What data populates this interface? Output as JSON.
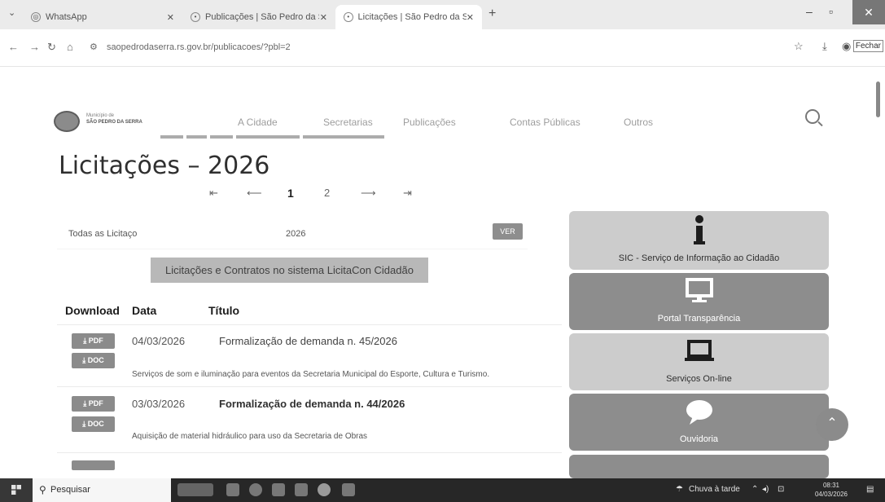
{
  "browser": {
    "tabs": [
      {
        "label": "WhatsApp"
      },
      {
        "label": "Publicações | São Pedro da Ser"
      },
      {
        "label": "Licitações | São Pedro da Serra"
      }
    ],
    "url": "saopedrodaserra.rs.gov.br/publicacoes/?pbl=2",
    "fechar_label": "Fechar"
  },
  "site": {
    "logo_small": "Município de",
    "logo_name": "SÃO PEDRO DA SERRA",
    "menu": [
      "A Cidade",
      "Secretarias",
      "Publicações",
      "Contas Públicas",
      "Outros"
    ]
  },
  "page": {
    "title": "Licitações – 2026",
    "pagination": {
      "first": "⇤",
      "prev": "⟵",
      "pages": [
        "1",
        "2"
      ],
      "next": "⟶",
      "last": "⇥"
    },
    "filter": {
      "category": "Todas as Licitaço",
      "year": "2026",
      "button": "VER"
    },
    "licitacon_button": "Licitações e Contratos no sistema LicitaCon Cidadão",
    "table": {
      "headers": [
        "Download",
        "Data",
        "Título"
      ],
      "pdf_label": "PDF",
      "doc_label": "DOC",
      "rows": [
        {
          "date": "04/03/2026",
          "title": "Formalização de demanda n. 45/2026",
          "desc": "Serviços de som e iluminação para eventos da Secretaria Municipal do Esporte, Cultura e Turismo."
        },
        {
          "date": "03/03/2026",
          "title": "Formalização de demanda n. 44/2026",
          "desc": "Aquisição de material hidráulico para uso da Secretaria de Obras"
        }
      ]
    }
  },
  "sidebar": {
    "cards": [
      {
        "label": "SIC - Serviço de Informação ao Cidadão",
        "icon": "info-icon"
      },
      {
        "label": "Portal Transparência",
        "icon": "monitor-icon"
      },
      {
        "label": "Serviços On-line",
        "icon": "laptop-icon"
      },
      {
        "label": "Ouvidoria",
        "icon": "chat-bubble-icon"
      }
    ]
  },
  "taskbar": {
    "search_placeholder": "Pesquisar",
    "weather": "Chuva à tarde",
    "time": "08:31",
    "date": "04/03/2026"
  }
}
